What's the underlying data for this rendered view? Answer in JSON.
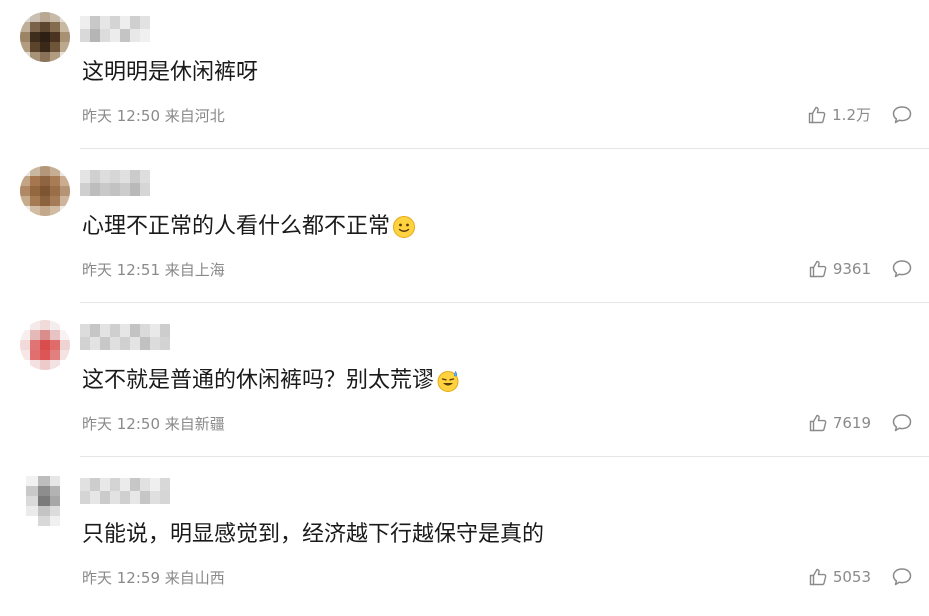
{
  "comments": [
    {
      "text": "这明明是休闲裤呀",
      "time": "昨天 12:50",
      "location": "来自河北",
      "likes": "1.2万",
      "emoji": ""
    },
    {
      "text": "心理不正常的人看什么都不正常",
      "time": "昨天 12:51",
      "location": "来自上海",
      "likes": "9361",
      "emoji": "slight-smile-emoji"
    },
    {
      "text": "这不就是普通的休闲裤吗？别太荒谬",
      "time": "昨天 12:50",
      "location": "来自新疆",
      "likes": "7619",
      "emoji": "sweat-smile-emoji"
    },
    {
      "text": "只能说，明显感觉到，经济越下行越保守是真的",
      "time": "昨天 12:59",
      "location": "来自山西",
      "likes": "5053",
      "emoji": ""
    }
  ],
  "colors": {
    "text": "#1a1a1a",
    "meta": "#8a8a8a",
    "divider": "#e6e6e6"
  },
  "icons": {
    "like": "thumbs-up-icon",
    "reply": "speech-bubble-icon"
  }
}
